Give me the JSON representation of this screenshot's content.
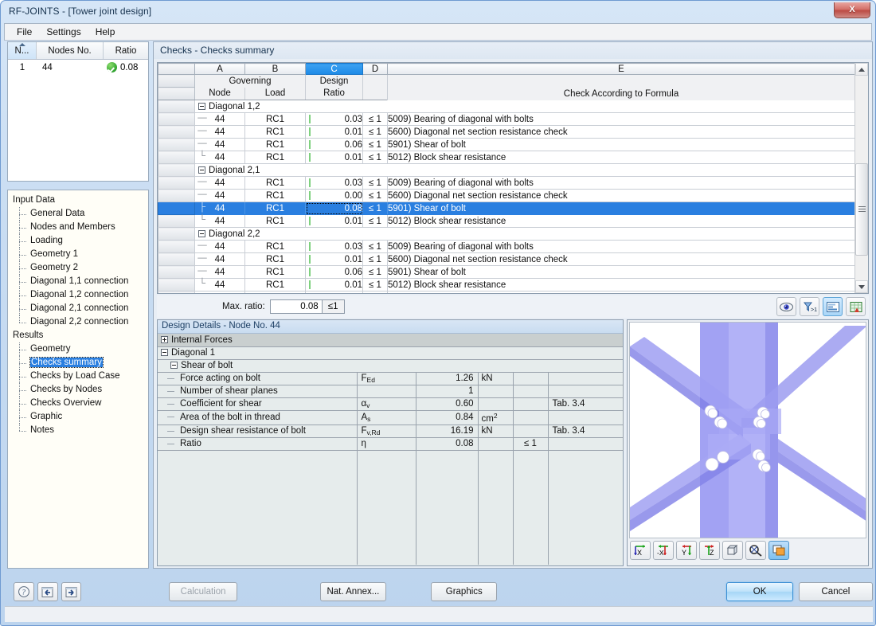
{
  "window": {
    "title": "RF-JOINTS - [Tower joint design]",
    "close_label": "X"
  },
  "menu": {
    "items": [
      "File",
      "Settings",
      "Help"
    ]
  },
  "node_list": {
    "headers": {
      "index": "N...",
      "nodes_no": "Nodes No.",
      "ratio": "Ratio"
    },
    "rows": [
      {
        "index": "1",
        "node": "44",
        "status_icon": "check-circle-icon",
        "ratio": "0.08"
      }
    ]
  },
  "nav_tree": {
    "groups": [
      {
        "label": "Input Data",
        "items": [
          "General Data",
          "Nodes and Members",
          "Loading",
          "Geometry 1",
          "Geometry 2",
          "Diagonal 1,1 connection",
          "Diagonal 1,2 connection",
          "Diagonal 2,1 connection",
          "Diagonal 2,2 connection"
        ]
      },
      {
        "label": "Results",
        "items": [
          "Geometry",
          "Checks summary",
          "Checks by Load Case",
          "Checks by Nodes",
          "Checks Overview",
          "Graphic",
          "Notes"
        ],
        "selected": "Checks summary"
      }
    ]
  },
  "main": {
    "title": "Checks - Checks summary",
    "table": {
      "column_letters": [
        "A",
        "B",
        "C",
        "D",
        "E"
      ],
      "active_column": "C",
      "subheaders_top": [
        "Governing",
        "",
        "Design",
        "",
        ""
      ],
      "subheaders_bottom": [
        "Node",
        "Load",
        "Ratio",
        "",
        "Check According to Formula"
      ],
      "groups": [
        {
          "label": "Diagonal 1,2",
          "rows": [
            {
              "node": "44",
              "load": "RC1",
              "ratio": "0.03",
              "limit": "≤ 1",
              "formula": "5009) Bearing of diagonal with bolts"
            },
            {
              "node": "44",
              "load": "RC1",
              "ratio": "0.01",
              "limit": "≤ 1",
              "formula": "5600) Diagonal net section resistance check"
            },
            {
              "node": "44",
              "load": "RC1",
              "ratio": "0.06",
              "limit": "≤ 1",
              "formula": "5901) Shear of bolt"
            },
            {
              "node": "44",
              "load": "RC1",
              "ratio": "0.01",
              "limit": "≤ 1",
              "formula": "5012) Block shear resistance"
            }
          ]
        },
        {
          "label": "Diagonal 2,1",
          "rows": [
            {
              "node": "44",
              "load": "RC1",
              "ratio": "0.03",
              "limit": "≤ 1",
              "formula": "5009) Bearing of diagonal with bolts"
            },
            {
              "node": "44",
              "load": "RC1",
              "ratio": "0.00",
              "limit": "≤ 1",
              "formula": "5600) Diagonal net section resistance check"
            },
            {
              "node": "44",
              "load": "RC1",
              "ratio": "0.08",
              "limit": "≤ 1",
              "formula": "5901) Shear of bolt",
              "selected": true
            },
            {
              "node": "44",
              "load": "RC1",
              "ratio": "0.01",
              "limit": "≤ 1",
              "formula": "5012) Block shear resistance"
            }
          ]
        },
        {
          "label": "Diagonal 2,2",
          "rows": [
            {
              "node": "44",
              "load": "RC1",
              "ratio": "0.03",
              "limit": "≤ 1",
              "formula": "5009) Bearing of diagonal with bolts"
            },
            {
              "node": "44",
              "load": "RC1",
              "ratio": "0.01",
              "limit": "≤ 1",
              "formula": "5600) Diagonal net section resistance check"
            },
            {
              "node": "44",
              "load": "RC1",
              "ratio": "0.06",
              "limit": "≤ 1",
              "formula": "5901) Shear of bolt"
            },
            {
              "node": "44",
              "load": "RC1",
              "ratio": "0.01",
              "limit": "≤ 1",
              "formula": "5012) Block shear resistance"
            }
          ]
        }
      ]
    },
    "max_ratio": {
      "label": "Max. ratio:",
      "value": "0.08",
      "limit": "≤1"
    },
    "result_tools": [
      {
        "name": "view-eye-icon"
      },
      {
        "name": "filter-gt1-icon"
      },
      {
        "name": "details-report-icon"
      },
      {
        "name": "export-excel-icon"
      }
    ]
  },
  "design_details": {
    "header": "Design Details  -  Node No. 44",
    "rows": [
      {
        "kind": "group",
        "expander": "plus",
        "label": "Internal Forces"
      },
      {
        "kind": "group",
        "expander": "minus",
        "label": "Diagonal 1"
      },
      {
        "kind": "sub",
        "expander": "minus",
        "label": "Shear of bolt"
      },
      {
        "kind": "item",
        "label": "Force acting on bolt",
        "symbol": "F",
        "symbol_sub": "Ed",
        "value": "1.26",
        "unit": "kN",
        "limit": "",
        "ref": ""
      },
      {
        "kind": "item",
        "label": "Number of shear planes",
        "symbol": "",
        "symbol_sub": "",
        "value": "1",
        "unit": "",
        "limit": "",
        "ref": ""
      },
      {
        "kind": "item",
        "label": "Coefficient for shear",
        "symbol": "α",
        "symbol_sub": "v",
        "value": "0.60",
        "unit": "",
        "limit": "",
        "ref": "Tab. 3.4"
      },
      {
        "kind": "item",
        "label": "Area of the bolt in thread",
        "symbol": "A",
        "symbol_sub": "s",
        "value": "0.84",
        "unit": "cm²",
        "limit": "",
        "ref": ""
      },
      {
        "kind": "item",
        "label": "Design shear resistance of bolt",
        "symbol": "F",
        "symbol_sub": "v,Rd",
        "value": "16.19",
        "unit": "kN",
        "limit": "",
        "ref": "Tab. 3.4"
      },
      {
        "kind": "item",
        "label": "Ratio",
        "symbol": "η",
        "symbol_sub": "",
        "value": "0.08",
        "unit": "",
        "limit": "≤ 1",
        "ref": ""
      }
    ]
  },
  "graphic": {
    "tools": [
      {
        "name": "view-x-axis-icon",
        "label": "X"
      },
      {
        "name": "view-neg-x-axis-icon",
        "label": "-X"
      },
      {
        "name": "view-y-axis-icon",
        "label": "Y"
      },
      {
        "name": "view-z-axis-icon",
        "label": "Z"
      },
      {
        "name": "isometric-view-icon",
        "label": ""
      },
      {
        "name": "zoom-select-icon",
        "label": ""
      },
      {
        "name": "render-mode-icon",
        "label": ""
      }
    ]
  },
  "footer": {
    "help_icon": "help-question-icon",
    "prev_icon": "previous-arrow-icon",
    "next_icon": "next-arrow-icon",
    "calculation": "Calculation",
    "nat_annex": "Nat. Annex...",
    "graphics": "Graphics",
    "ok": "OK",
    "cancel": "Cancel"
  },
  "colors": {
    "accent_blue": "#2a7fe0",
    "header_active": "#1e8ae6",
    "ok_green": "#2ea32e",
    "member_blue": "#8e8ef0"
  }
}
